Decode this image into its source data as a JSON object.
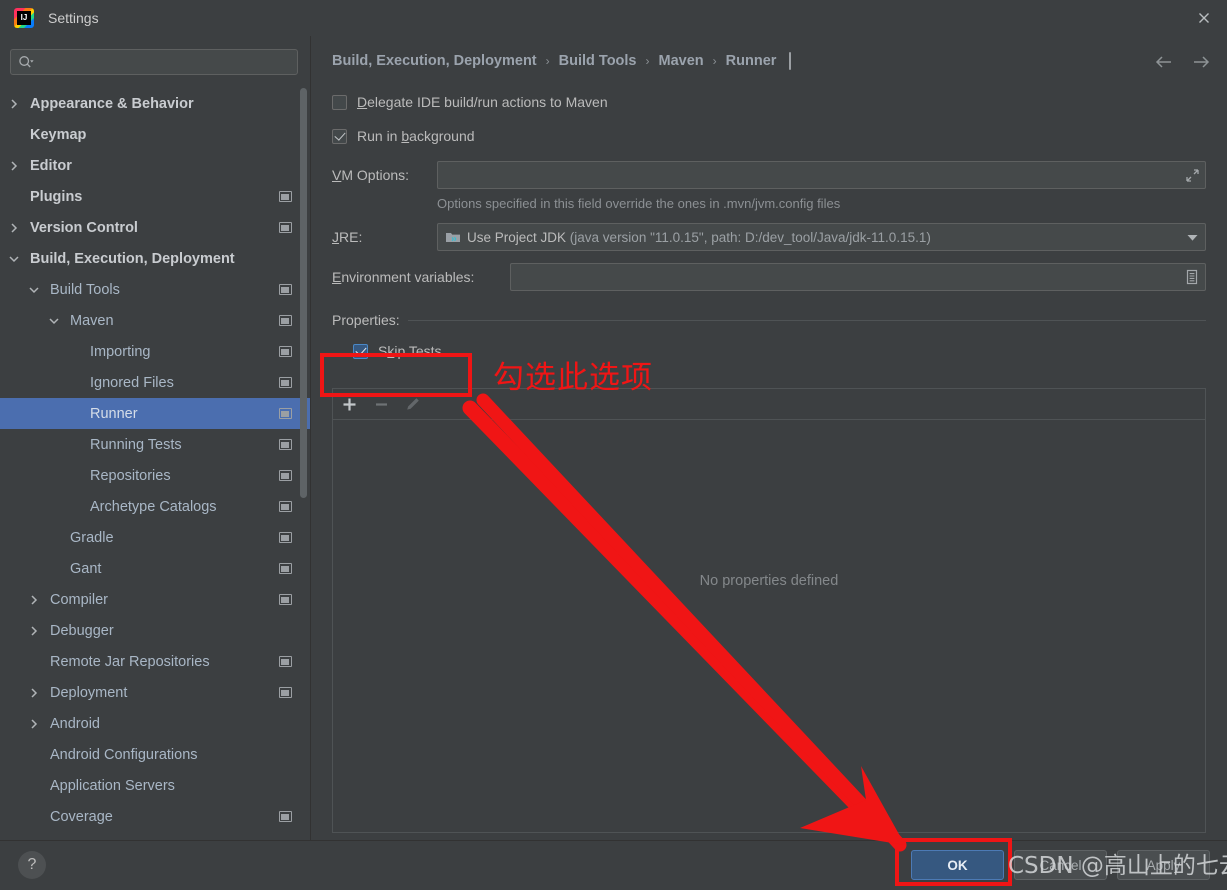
{
  "window": {
    "title": "Settings",
    "app_icon": "intellij-idea-icon",
    "close_icon": "close-icon"
  },
  "sidebar": {
    "search": {
      "placeholder": "",
      "value": "",
      "icon": "search-icon"
    },
    "items": [
      {
        "label": "Appearance & Behavior",
        "indent": 0,
        "arrow": "collapsed",
        "bold": true,
        "badge": false
      },
      {
        "label": "Keymap",
        "indent": 0,
        "arrow": "none",
        "bold": true,
        "badge": false
      },
      {
        "label": "Editor",
        "indent": 0,
        "arrow": "collapsed",
        "bold": true,
        "badge": false
      },
      {
        "label": "Plugins",
        "indent": 0,
        "arrow": "none",
        "bold": true,
        "badge": true
      },
      {
        "label": "Version Control",
        "indent": 0,
        "arrow": "collapsed",
        "bold": true,
        "badge": true
      },
      {
        "label": "Build, Execution, Deployment",
        "indent": 0,
        "arrow": "expanded",
        "bold": true,
        "badge": false
      },
      {
        "label": "Build Tools",
        "indent": 1,
        "arrow": "expanded",
        "bold": false,
        "badge": true
      },
      {
        "label": "Maven",
        "indent": 2,
        "arrow": "expanded",
        "bold": false,
        "badge": true
      },
      {
        "label": "Importing",
        "indent": 3,
        "arrow": "none",
        "bold": false,
        "badge": true
      },
      {
        "label": "Ignored Files",
        "indent": 3,
        "arrow": "none",
        "bold": false,
        "badge": true
      },
      {
        "label": "Runner",
        "indent": 3,
        "arrow": "none",
        "bold": false,
        "badge": true,
        "selected": true
      },
      {
        "label": "Running Tests",
        "indent": 3,
        "arrow": "none",
        "bold": false,
        "badge": true
      },
      {
        "label": "Repositories",
        "indent": 3,
        "arrow": "none",
        "bold": false,
        "badge": true
      },
      {
        "label": "Archetype Catalogs",
        "indent": 3,
        "arrow": "none",
        "bold": false,
        "badge": true
      },
      {
        "label": "Gradle",
        "indent": 2,
        "arrow": "none",
        "bold": false,
        "badge": true
      },
      {
        "label": "Gant",
        "indent": 2,
        "arrow": "none",
        "bold": false,
        "badge": true
      },
      {
        "label": "Compiler",
        "indent": 1,
        "arrow": "collapsed",
        "bold": false,
        "badge": true
      },
      {
        "label": "Debugger",
        "indent": 1,
        "arrow": "collapsed",
        "bold": false,
        "badge": false
      },
      {
        "label": "Remote Jar Repositories",
        "indent": 1,
        "arrow": "none",
        "bold": false,
        "badge": true
      },
      {
        "label": "Deployment",
        "indent": 1,
        "arrow": "collapsed",
        "bold": false,
        "badge": true
      },
      {
        "label": "Android",
        "indent": 1,
        "arrow": "collapsed",
        "bold": false,
        "badge": false
      },
      {
        "label": "Android Configurations",
        "indent": 1,
        "arrow": "none",
        "bold": false,
        "badge": false
      },
      {
        "label": "Application Servers",
        "indent": 1,
        "arrow": "none",
        "bold": false,
        "badge": false
      },
      {
        "label": "Coverage",
        "indent": 1,
        "arrow": "none",
        "bold": false,
        "badge": true
      }
    ]
  },
  "breadcrumb": {
    "parts": [
      "Build, Execution, Deployment",
      "Build Tools",
      "Maven",
      "Runner"
    ],
    "separator": "›",
    "badge_icon": "settings-badge-icon"
  },
  "nav": {
    "back_icon": "arrow-left-icon",
    "forward_icon": "arrow-right-icon"
  },
  "main": {
    "delegate_checkbox": {
      "label_pre": "D",
      "label_post": "elegate IDE build/run actions to Maven",
      "checked": false
    },
    "background_checkbox": {
      "label_pre_plain": "Run in ",
      "label_u": "b",
      "label_post": "ackground",
      "checked": true
    },
    "vm_options": {
      "label_u": "V",
      "label_rest": "M Options:",
      "value": "",
      "expand_icon": "expand-icon"
    },
    "vm_hint": "Options specified in this field override the ones in .mvn/jvm.config files",
    "jre": {
      "label_u": "J",
      "label_rest": "RE:",
      "icon": "jdk-folder-icon",
      "value_main": "Use Project JDK",
      "value_detail": "(java version \"11.0.15\", path: D:/dev_tool/Java/jdk-11.0.15.1)",
      "arrow_icon": "chevron-down-icon"
    },
    "env_vars": {
      "label_u": "E",
      "label_rest": "nvironment variables:",
      "value": "",
      "browse_icon": "list-editor-icon"
    },
    "properties_label": "Properties:",
    "skip_tests": {
      "label_pre": "S",
      "label_u": "k",
      "label_post": "ip Tests",
      "checked": true
    },
    "toolbar": {
      "add_icon": "plus-icon",
      "remove_icon": "minus-icon",
      "edit_icon": "pencil-icon"
    },
    "empty_text": "No properties defined"
  },
  "bottom": {
    "help_label": "?",
    "ok_label": "OK",
    "cancel_label": "Cancel",
    "apply_label": "Apply"
  },
  "annotations": {
    "callout_text": "勾选此选项",
    "color": "#f01515",
    "watermark": "CSDN @高山上的七云"
  }
}
